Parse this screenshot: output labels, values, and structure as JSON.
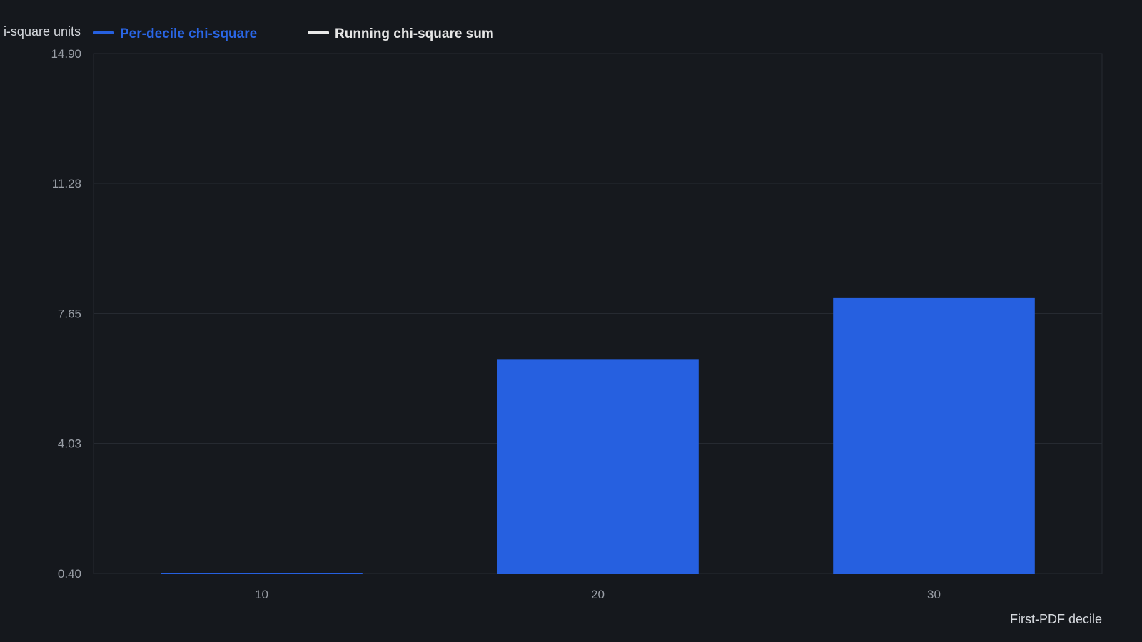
{
  "chart_data": {
    "type": "bar",
    "ylabel": "i-square units",
    "xlabel": "First-PDF decile",
    "categories": [
      "10",
      "20",
      "30"
    ],
    "ylim": [
      0.4,
      14.9
    ],
    "yticks": [
      "14.90",
      "11.28",
      "7.65",
      "4.03",
      "0.40"
    ],
    "grid": true,
    "legend_placement": "top-left",
    "series": [
      {
        "name": "Per-decile chi-square",
        "type": "bar",
        "color": "#2660e0",
        "values": [
          0.35,
          6.38,
          8.08
        ]
      },
      {
        "name": "Running chi-square sum",
        "type": "line",
        "color": "#e8e8e8",
        "values": []
      }
    ]
  }
}
